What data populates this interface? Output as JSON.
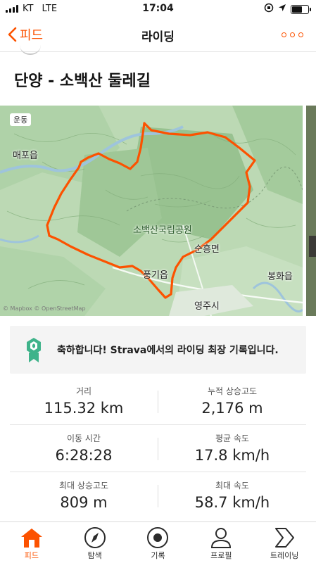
{
  "status_bar": {
    "carrier": "KT",
    "network": "LTE",
    "time": "17:04"
  },
  "nav": {
    "back_label": "피드",
    "title": "라이딩"
  },
  "activity": {
    "title": "단양 - 소백산 둘레길"
  },
  "map": {
    "chip": "운동",
    "labels": {
      "maepo": "매포읍",
      "park": "소백산국립공원",
      "sunheung": "순흥면",
      "punggi": "풍기읍",
      "bonghwa": "봉화읍",
      "yeongju": "영주시"
    },
    "credit": "© Mapbox © OpenStreetMap",
    "route_color": "#fc5200"
  },
  "achievement": {
    "message": "축하합니다! Strava에서의 라이딩 최장 기록입니다.",
    "medal_color": "#3fb38a"
  },
  "stats": [
    {
      "left": {
        "label": "거리",
        "value": "115.32 km"
      },
      "right": {
        "label": "누적 상승고도",
        "value": "2,176 m"
      }
    },
    {
      "left": {
        "label": "이동 시간",
        "value": "6:28:28"
      },
      "right": {
        "label": "평균 속도",
        "value": "17.8 km/h"
      }
    },
    {
      "left": {
        "label": "최대 상승고도",
        "value": "809 m"
      },
      "right": {
        "label": "최대 속도",
        "value": "58.7 km/h"
      }
    }
  ],
  "tabs": [
    {
      "label": "피드",
      "icon": "home-icon",
      "active": true
    },
    {
      "label": "탐색",
      "icon": "compass-icon",
      "active": false
    },
    {
      "label": "기록",
      "icon": "record-icon",
      "active": false
    },
    {
      "label": "프로필",
      "icon": "profile-icon",
      "active": false
    },
    {
      "label": "트레이닝",
      "icon": "training-icon",
      "active": false
    }
  ],
  "colors": {
    "accent": "#fc5200",
    "map_green": "#b9d8b3",
    "map_dark": "#95c08f"
  }
}
